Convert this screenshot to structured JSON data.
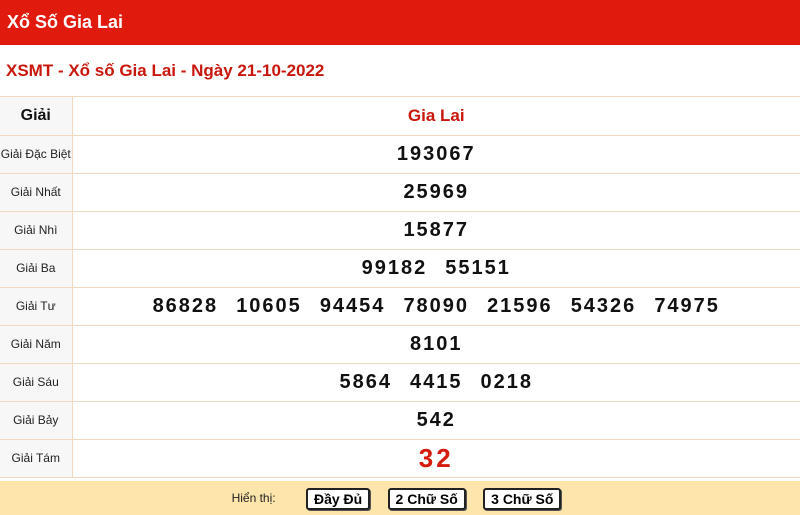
{
  "header": {
    "title": "Xổ Số Gia Lai"
  },
  "subtitle": "XSMT - Xổ số Gia Lai - Ngày 21-10-2022",
  "table": {
    "col_label": "Giải",
    "col_province": "Gia Lai",
    "rows": [
      {
        "label": "Giải Đặc Biệt",
        "numbers": [
          "193067"
        ]
      },
      {
        "label": "Giải Nhất",
        "numbers": [
          "25969"
        ]
      },
      {
        "label": "Giải Nhì",
        "numbers": [
          "15877"
        ]
      },
      {
        "label": "Giải Ba",
        "numbers": [
          "99182",
          "55151"
        ]
      },
      {
        "label": "Giải Tư",
        "numbers": [
          "86828",
          "10605",
          "94454",
          "78090",
          "21596",
          "54326",
          "74975"
        ]
      },
      {
        "label": "Giải Năm",
        "numbers": [
          "8101"
        ]
      },
      {
        "label": "Giải Sáu",
        "numbers": [
          "5864",
          "4415",
          "0218"
        ]
      },
      {
        "label": "Giải Bảy",
        "numbers": [
          "542"
        ]
      },
      {
        "label": "Giải Tám",
        "numbers": [
          "32"
        ]
      }
    ]
  },
  "footer": {
    "label": "Hiển thị:",
    "buttons": [
      "Đầy Đủ",
      "2 Chữ Số",
      "3 Chữ Số"
    ]
  },
  "colors": {
    "brand": "#e01b0e",
    "accent_text": "#c8170c",
    "footer_bg": "#fde5ab"
  }
}
